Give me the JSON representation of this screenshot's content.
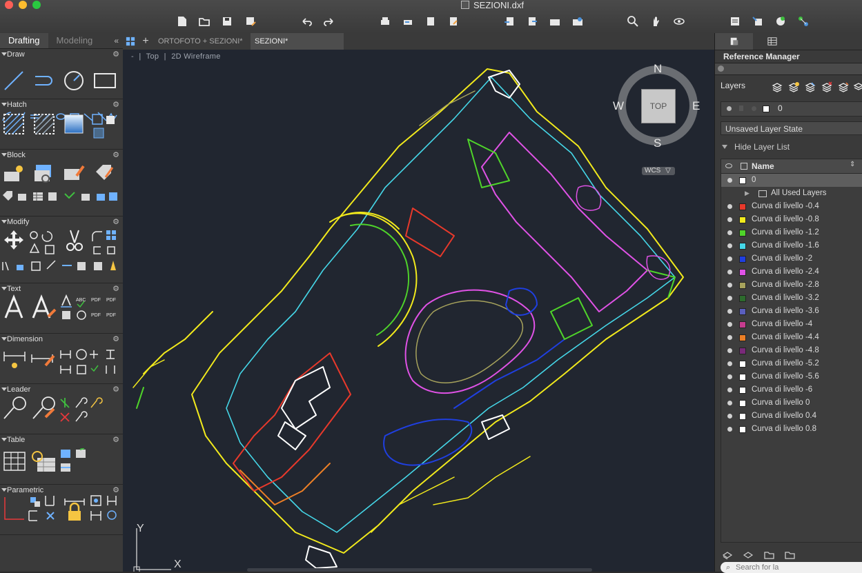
{
  "window": {
    "title": "SEZIONI.dxf"
  },
  "toolbar_icons": [
    "new-file-icon",
    "open-folder-icon",
    "save-icon",
    "save-as-icon",
    "undo-icon",
    "redo-icon",
    "plot-icon",
    "batch-plot-icon",
    "publish-icon",
    "export-icon",
    "import-icon",
    "attach-icon",
    "xref-icon",
    "external-data-icon",
    "zoom-icon",
    "pan-hand-icon",
    "orbit-icon",
    "layer-properties-icon",
    "match-layer-icon",
    "add-layer-icon",
    "layer-states-icon"
  ],
  "left_panel": {
    "tabs": [
      "Drafting",
      "Modeling"
    ],
    "active_tab": "Drafting",
    "collapse": "«",
    "sections": [
      {
        "id": "draw",
        "label": "Draw"
      },
      {
        "id": "hatch",
        "label": "Hatch"
      },
      {
        "id": "block",
        "label": "Block"
      },
      {
        "id": "modify",
        "label": "Modify"
      },
      {
        "id": "text",
        "label": "Text"
      },
      {
        "id": "dimension",
        "label": "Dimension"
      },
      {
        "id": "leader",
        "label": "Leader"
      },
      {
        "id": "table",
        "label": "Table"
      },
      {
        "id": "parametric",
        "label": "Parametric"
      }
    ]
  },
  "file_tabs": {
    "items": [
      "ORTOFOTO + SEZIONI*",
      "SEZIONI*"
    ],
    "active": "SEZIONI*"
  },
  "viewport": {
    "controls": {
      "minus": "-",
      "view": "Top",
      "style": "2D Wireframe"
    },
    "viewcube": {
      "face": "TOP",
      "n": "N",
      "s": "S",
      "e": "E",
      "w": "W",
      "wcs": "WCS"
    },
    "ucs": {
      "y": "Y",
      "x": "X"
    }
  },
  "right_panel": {
    "title": "Reference Manager",
    "layers_title": "Layers",
    "current_layer": "0",
    "layer_state": "Unsaved Layer State",
    "hide_layer_list": "Hide Layer List",
    "column_name": "Name",
    "search_placeholder": "Search for la",
    "layers": [
      {
        "name": "0",
        "color": "#ffffff",
        "selected": true
      },
      {
        "name": "All Used Layers",
        "group": true
      },
      {
        "name": "Curva di livello -0.4",
        "color": "#e8392b"
      },
      {
        "name": "Curva di livello -0.8",
        "color": "#f2ea1c"
      },
      {
        "name": "Curva di livello -1.2",
        "color": "#4fd42a"
      },
      {
        "name": "Curva di livello -1.6",
        "color": "#45d7e8"
      },
      {
        "name": "Curva di livello -2",
        "color": "#1f3fe0"
      },
      {
        "name": "Curva di livello -2.4",
        "color": "#e052e6"
      },
      {
        "name": "Curva di livello -2.8",
        "color": "#a7a35c"
      },
      {
        "name": "Curva di livello -3.2",
        "color": "#2d6b2d"
      },
      {
        "name": "Curva di livello -3.6",
        "color": "#5a5fbf"
      },
      {
        "name": "Curva di livello -4",
        "color": "#c73c8f"
      },
      {
        "name": "Curva di livello -4.4",
        "color": "#ec7f26"
      },
      {
        "name": "Curva di livello -4.8",
        "color": "#7a2a7a"
      },
      {
        "name": "Curva di livello -5.2",
        "color": "#ffffff"
      },
      {
        "name": "Curva di livello -5.6",
        "color": "#ffffff"
      },
      {
        "name": "Curva di livello -6",
        "color": "#ffffff"
      },
      {
        "name": "Curva di livello 0",
        "color": "#ffffff"
      },
      {
        "name": "Curva di livello 0.4",
        "color": "#ffffff"
      },
      {
        "name": "Curva di livello 0.8",
        "color": "#ffffff"
      }
    ]
  }
}
